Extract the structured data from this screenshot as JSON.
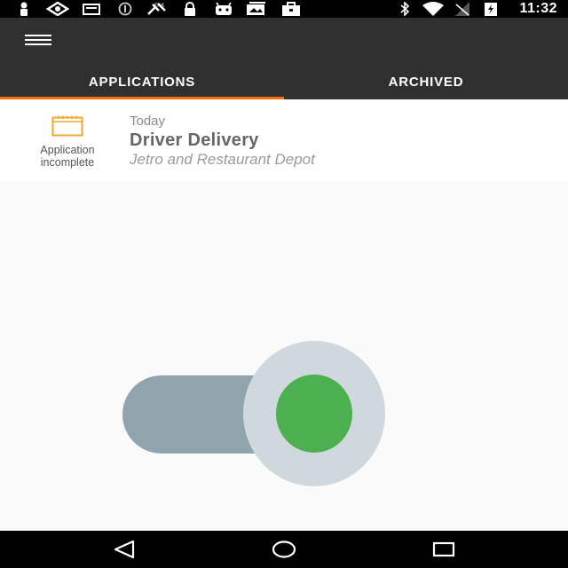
{
  "status_bar": {
    "time": "11:32",
    "icons": [
      "person-icon",
      "eye-icon",
      "cards-icon",
      "circle-icon",
      "satellite-icon",
      "lock-icon",
      "android-icon",
      "image-icon",
      "briefcase-icon",
      "bluetooth-icon",
      "wifi-icon",
      "no-signal-icon",
      "battery-charging-icon"
    ]
  },
  "app_bar": {
    "menu_icon": "menu-icon",
    "tabs": [
      {
        "label": "APPLICATIONS",
        "selected": true
      },
      {
        "label": "ARCHIVED",
        "selected": false
      }
    ],
    "indicator_color": "#ff6d00"
  },
  "application": {
    "status_label_line1": "Application",
    "status_label_line2": "incomplete",
    "status_icon": "calendar-icon",
    "status_color": "#f0a830",
    "date": "Today",
    "title": "Driver Delivery",
    "company": "Jetro and Restaurant Depot"
  },
  "empty_state": {
    "illustration": "toggle-switch-illustration",
    "toggle_on_color": "#4caf50"
  },
  "nav_bar": {
    "icons": [
      "back-icon",
      "home-icon",
      "recents-icon"
    ]
  }
}
